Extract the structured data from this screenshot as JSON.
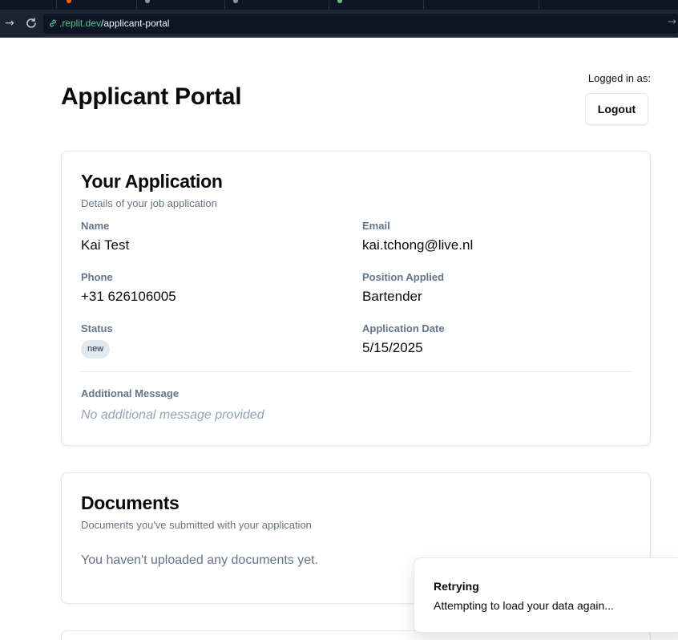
{
  "browser": {
    "url_host": ".replit.dev",
    "url_path": "/applicant-portal",
    "url_color": "#58c48a"
  },
  "header": {
    "title": "Applicant Portal",
    "logged_in_label": "Logged in as:",
    "logout_label": "Logout"
  },
  "application": {
    "title": "Your Application",
    "subtitle": "Details of your job application",
    "fields": {
      "name": {
        "label": "Name",
        "value": "Kai Test"
      },
      "email": {
        "label": "Email",
        "value": "kai.tchong@live.nl"
      },
      "phone": {
        "label": "Phone",
        "value": "+31 626106005"
      },
      "position": {
        "label": "Position Applied",
        "value": "Bartender"
      },
      "status": {
        "label": "Status",
        "value": "new"
      },
      "date": {
        "label": "Application Date",
        "value": "5/15/2025"
      }
    },
    "message": {
      "label": "Additional Message",
      "value": "No additional message provided"
    }
  },
  "documents": {
    "title": "Documents",
    "subtitle": "Documents you've submitted with your application",
    "empty_text": "You haven't uploaded any documents yet."
  },
  "toast": {
    "title": "Retrying",
    "description": "Attempting to load your data again..."
  }
}
